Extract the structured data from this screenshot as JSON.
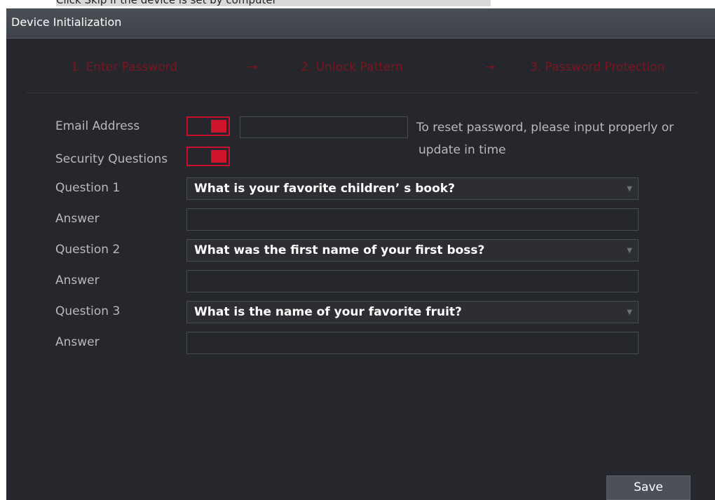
{
  "top_strip": {
    "text": "Click Skip if the device is set by computer"
  },
  "window": {
    "title": "Device Initialization"
  },
  "steps": {
    "step1": "1.  Enter Password",
    "arrow1": "→",
    "step2": "2.  Unlock Pattern",
    "arrow2": "→",
    "step3": "3.  Password Protection"
  },
  "form": {
    "email_label": "Email Address",
    "email_value": "",
    "email_toggle": "on",
    "hint_line1": "To reset password, please input properly or",
    "hint_line2": "update in time",
    "security_label": "Security Questions",
    "security_toggle": "on",
    "q1_label": "Question 1",
    "q1_value": "What is your favorite children’ s book?",
    "a1_label": "Answer",
    "a1_value": "",
    "q2_label": "Question 2",
    "q2_value": "What was the first name of your first boss?",
    "a2_label": "Answer",
    "a2_value": "",
    "q3_label": "Question 3",
    "q3_value": "What is the name of your favorite fruit?",
    "a3_label": "Answer",
    "a3_value": ""
  },
  "buttons": {
    "save": "Save"
  },
  "icons": {
    "dropdown": "chevron-down-icon",
    "arrow": "arrow-right-icon"
  },
  "colors": {
    "accent": "#d0152b",
    "step_text": "#7a1520",
    "background": "#26272c"
  }
}
